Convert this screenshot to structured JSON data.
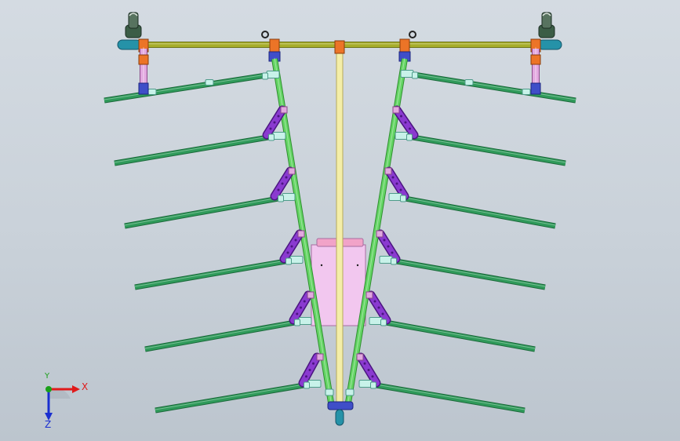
{
  "view": {
    "background_top": "#d4dbe2",
    "background_bottom": "#bcc5ce"
  },
  "colors": {
    "crossbar": "#a7ad2a",
    "crossbar_dark": "#6e7418",
    "arm": "#2f9a5a",
    "arm_dark": "#1c6a3b",
    "frame": "#63d463",
    "frame_dark": "#2f8f2f",
    "mast": "#f4eea8",
    "mast_edge": "#b6a95a",
    "bracket": "#8a3ad0",
    "bracket_dark": "#4b1580",
    "clamp": "#c8f2e9",
    "clamp_edge": "#4e9b8a",
    "plate": "#f2c7ef",
    "plate_edge": "#a86ca0",
    "plate_top": "#f1a3c8",
    "orange_block": "#ec7427",
    "blue_block": "#3f4ec8",
    "teal_cap": "#2592a8",
    "pink_link": "#e2a8e0"
  },
  "elements": {
    "arm_count": 6,
    "frame_sides": [
      "left",
      "right"
    ],
    "bracket_count": 5
  },
  "axes": {
    "x_label": "X",
    "y_label": "Y",
    "z_label": "Z",
    "x_color": "#e01a1a",
    "y_color": "#1aa01a",
    "z_color": "#1a2fd0"
  }
}
